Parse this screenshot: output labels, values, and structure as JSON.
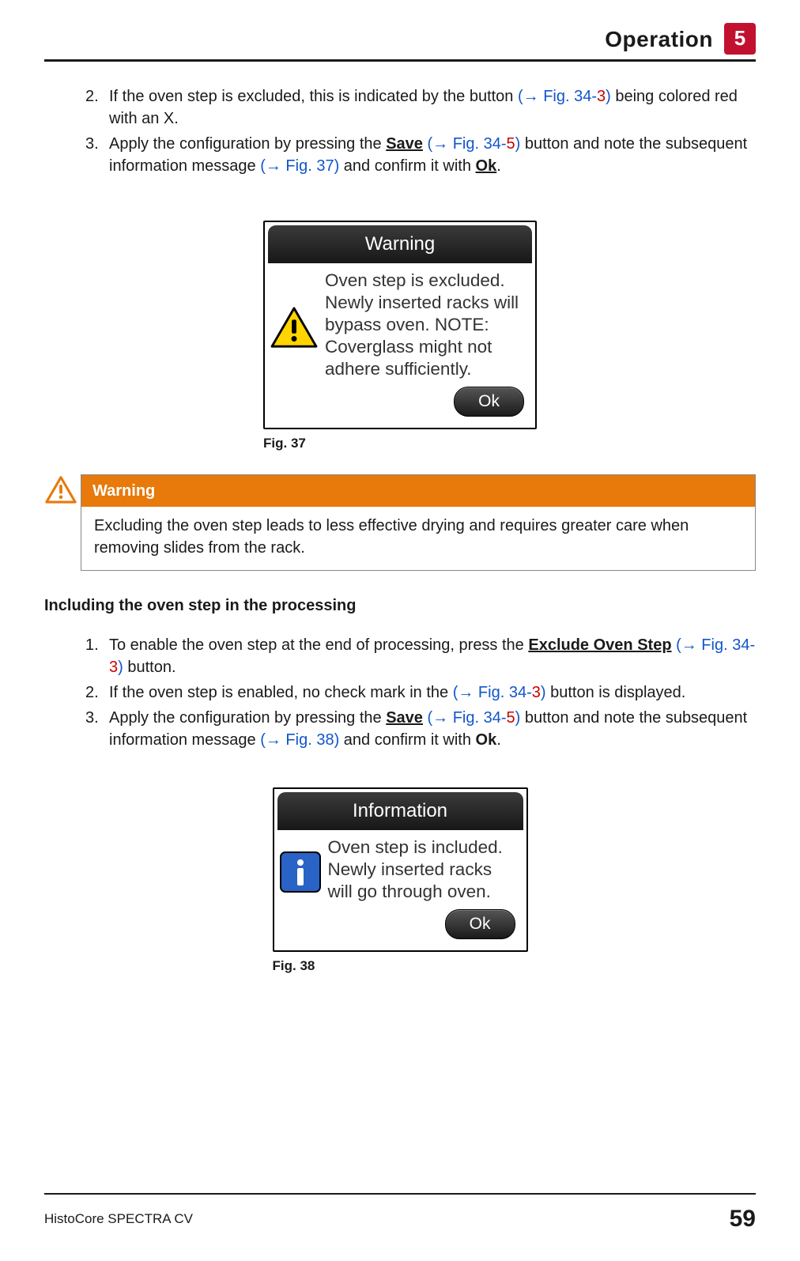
{
  "header": {
    "title": "Operation",
    "chapter": "5"
  },
  "steps_a": {
    "start": 2,
    "items": [
      {
        "num": "2.",
        "pre": "If the oven step is excluded, this is indicated by the button ",
        "ref1_open": "(→ Fig.  34",
        "ref1_dash": "-",
        "ref1_num": "3",
        "ref1_close": ")",
        "post": " being colored red with an X."
      },
      {
        "num": "3.",
        "pre": "Apply the configuration by pressing the ",
        "save": "Save",
        "mid1_open": " (→ Fig.  34",
        "mid1_dash": "-",
        "mid1_num": "5",
        "mid1_close": ")",
        "mid2": " button and note the subsequent information message ",
        "ref2": "(→ Fig.  37)",
        "mid3": " and confirm it with ",
        "ok": "Ok",
        "end": "."
      }
    ]
  },
  "fig37": {
    "caption": "Fig.  37",
    "title": "Warning",
    "body": "Oven step is excluded. Newly inserted racks will bypass oven. NOTE: Coverglass might not adhere sufficiently.",
    "ok": "Ok"
  },
  "warning_box": {
    "title": "Warning",
    "body": "Excluding the oven step leads to less effective drying and requires greater care when removing slides from the rack."
  },
  "subhead": "Including the oven step in the processing",
  "steps_b": {
    "items": [
      {
        "num": "1.",
        "pre": "To enable the oven step at the end of processing, press the ",
        "btn": "Exclude Oven Step",
        "ref_open": " (→ Fig.  34",
        "ref_dash": "-",
        "ref_num": "3",
        "ref_close": ")",
        "post": " button."
      },
      {
        "num": "2.",
        "pre": "If the oven step is enabled, no check mark in the ",
        "ref_open": "(→ Fig.  34",
        "ref_dash": "-",
        "ref_num": "3",
        "ref_close": ")",
        "post": " button is displayed."
      },
      {
        "num": "3.",
        "pre": "Apply the configuration by pressing the ",
        "save": "Save",
        "mid1_open": " (→ Fig.  34",
        "mid1_dash": "-",
        "mid1_num": "5",
        "mid1_close": ")",
        "mid2": " button and note the subsequent information message ",
        "ref2": "(→ Fig.  38)",
        "mid3": " and confirm it with ",
        "ok": "Ok",
        "end": "."
      }
    ]
  },
  "fig38": {
    "caption": "Fig.  38",
    "title": "Information",
    "body": "Oven step is included. Newly inserted racks will go through oven.",
    "ok": "Ok"
  },
  "footer": {
    "product": "HistoCore SPECTRA CV",
    "page": "59"
  }
}
